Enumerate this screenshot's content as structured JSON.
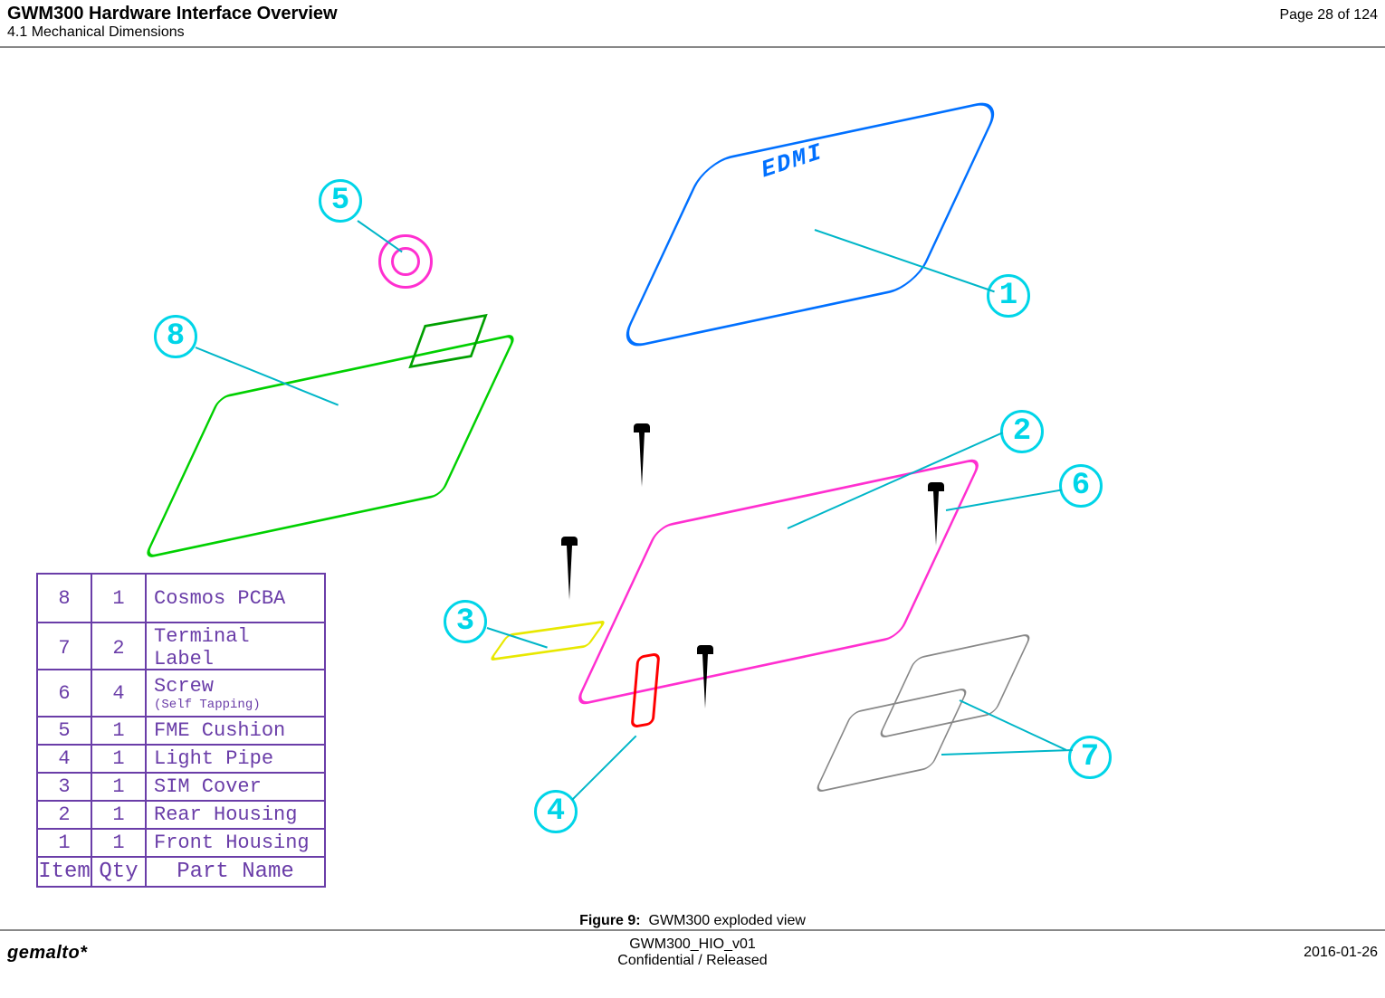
{
  "header": {
    "doc_title": "GWM300 Hardware Interface Overview",
    "section": "4.1 Mechanical Dimensions",
    "page_of": "Page 28 of 124"
  },
  "figure": {
    "caption_label": "Figure 9:",
    "caption_text": "GWM300 exploded view",
    "device_logo": "EDMI",
    "callouts": {
      "c1": "1",
      "c2": "2",
      "c3": "3",
      "c4": "4",
      "c5": "5",
      "c6": "6",
      "c7": "7",
      "c8": "8"
    }
  },
  "bom": {
    "headers": {
      "item": "Item",
      "qty": "Qty",
      "name": "Part Name"
    },
    "rows": [
      {
        "item": "8",
        "qty": "1",
        "name": "Cosmos PCBA"
      },
      {
        "item": "7",
        "qty": "2",
        "name": "Terminal Label"
      },
      {
        "item": "6",
        "qty": "4",
        "name": "Screw",
        "sub": "(Self Tapping)"
      },
      {
        "item": "5",
        "qty": "1",
        "name": "FME Cushion"
      },
      {
        "item": "4",
        "qty": "1",
        "name": "Light Pipe"
      },
      {
        "item": "3",
        "qty": "1",
        "name": "SIM Cover"
      },
      {
        "item": "2",
        "qty": "1",
        "name": "Rear Housing"
      },
      {
        "item": "1",
        "qty": "1",
        "name": "Front Housing"
      }
    ]
  },
  "footer": {
    "brand": "gemalto*",
    "doc_id": "GWM300_HIO_v01",
    "classification": "Confidential / Released",
    "date": "2016-01-26"
  }
}
